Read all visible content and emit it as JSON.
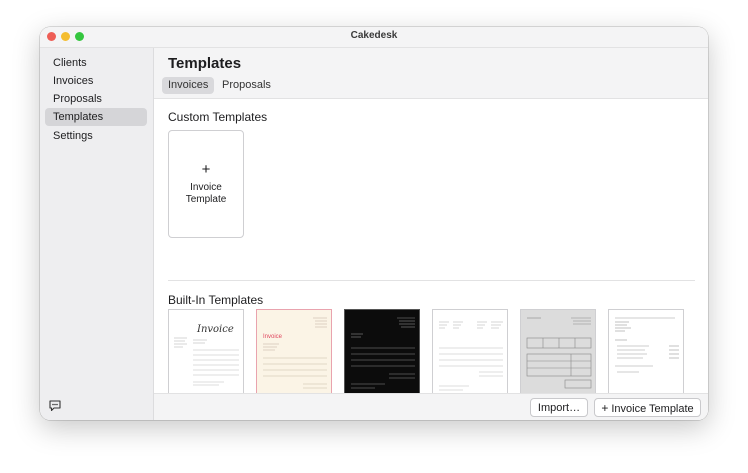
{
  "window": {
    "title": "Cakedesk"
  },
  "sidebar": {
    "items": [
      {
        "label": "Clients"
      },
      {
        "label": "Invoices"
      },
      {
        "label": "Proposals"
      },
      {
        "label": "Templates",
        "active": true
      },
      {
        "label": "Settings"
      }
    ],
    "feedback_icon": "chat-bubble-icon"
  },
  "header": {
    "title": "Templates",
    "tabs": [
      {
        "label": "Invoices",
        "active": true
      },
      {
        "label": "Proposals"
      }
    ]
  },
  "custom_templates": {
    "title": "Custom Templates",
    "add_card": {
      "icon": "+",
      "label_line1": "Invoice",
      "label_line2": "Template"
    }
  },
  "builtin_templates": {
    "title": "Built-In Templates",
    "thumbnails": [
      {
        "style": "script-classic",
        "heading": "Invoice"
      },
      {
        "style": "cream-red",
        "heading": "Invoice"
      },
      {
        "style": "dark"
      },
      {
        "style": "minimal-columns"
      },
      {
        "style": "gray-grid"
      },
      {
        "style": "simple-list"
      }
    ]
  },
  "footer": {
    "import_label": "Import…",
    "new_template_icon": "+",
    "new_template_label": "Invoice Template"
  },
  "colors": {
    "accent_red": "#e0475f",
    "sidebar_bg": "#eeeef0",
    "selected_bg": "#d5d5d8"
  }
}
